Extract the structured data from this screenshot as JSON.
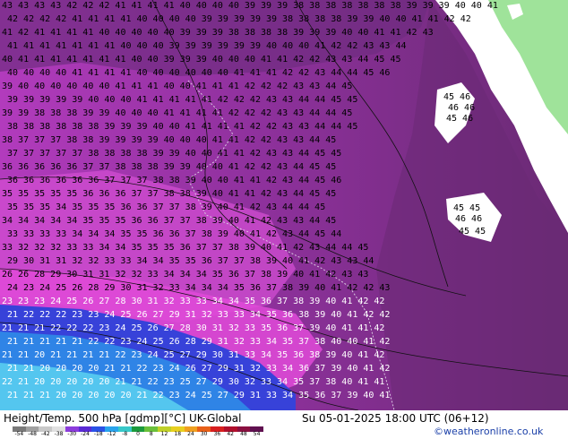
{
  "map": {
    "background": "#7a2f84",
    "land_color": "#9fe39a",
    "ocean_color": "#ffffff",
    "field_colors": {
      "warm_edge": "#5d2567",
      "mid": "#8a2e98",
      "bright": "#c040c8",
      "cool": "#e044d8",
      "cold_band": "#3c3cdc",
      "colder": "#2f8ee6",
      "coldest": "#55c8f0"
    },
    "contour_labels": [
      {
        "row": "row-42",
        "text": "43 43 43 43 42 42 42 41 41 41 41 40 40 40 40 39 39 39 38 38 38 38 38 38 38 39 39 39 40 40 41"
      },
      {
        "row": "row-41",
        "text": "42 42 42 42 41 41 41 41 40 40 40 40 39 39 39 39 39 38 38 38 38 39 39 40 40 41 41 42 42"
      },
      {
        "row": "row-40",
        "text": "41 42 41 41 41 41 40 40 40 40 40 39 39 39 38 38 38 38 39 39 39 40 40 41 41 42 43"
      },
      {
        "row": "row-39",
        "text": "41 41 41 41 41 41 41 40 40 40 39 39 39 39 39 39 40 40 40 41 42 42 43 43 44"
      },
      {
        "row": "row-38",
        "text": "40 41 41 41 41 41 41 41 40 40 39 39 39 40 40 40 41 41 42 42 43 43 44 45 45"
      },
      {
        "row": "row-37",
        "text": "40 40 40 40 41 41 41 41 40 40 40 40 40 40 41 41 41 42 42 43 44 44 45 46"
      },
      {
        "row": "row-36",
        "text": "39 40 40 40 40 40 40 41 41 41 40 40 41 41 41 42 42 42 43 43 44 45"
      },
      {
        "row": "row-35",
        "text": "39 39 39 39 39 40 40 40 41 41 41 41 41 42 42 42 43 43 44 44 45 45"
      },
      {
        "row": "row-34",
        "text": "39 39 38 38 38 39 39 40 40 40 41 41 41 41 42 42 42 43 43 44 44 45"
      },
      {
        "row": "row-33",
        "text": "38 38 38 38 38 38 39 39 39 40 40 41 41 41 41 42 42 43 43 44 44 45"
      },
      {
        "row": "row-32",
        "text": "38 37 37 37 38 38 39 39 39 39 40 40 40 41 41 42 42 43 43 44 45"
      },
      {
        "row": "row-31",
        "text": "37 37 37 37 37 38 38 38 38 39 39 40 40 41 41 42 43 43 44 45 45"
      },
      {
        "row": "row-30",
        "text": "36 36 36 36 36 37 37 38 38 38 39 39 40 40 41 42 42 43 44 45 45"
      },
      {
        "row": "row-29",
        "text": "36 36 36 36 36 36 37 37 37 38 38 39 40 40 41 41 42 43 44 45 46"
      },
      {
        "row": "row-28",
        "text": "35 35 35 35 35 36 36 36 37 37 38 38 39 40 41 41 42 43 44 45 45"
      },
      {
        "row": "row-27",
        "text": "35 35 35 34 35 35 35 36 36 37 37 38 39 40 41 42 43 44 44 45"
      },
      {
        "row": "row-26",
        "text": "34 34 34 34 34 35 35 35 36 36 37 37 38 39 40 41 42 43 43 44 45"
      },
      {
        "row": "row-25",
        "text": "33 33 33 33 34 34 34 35 35 36 36 37 38 39 40 41 42 43 44 45 44"
      },
      {
        "row": "row-24",
        "text": "33 32 32 32 33 33 34 34 35 35 35 36 37 37 38 39 40 41 42 43 44 44 45"
      },
      {
        "row": "row-23",
        "text": "29 30 31 31 32 32 33 33 34 34 35 35 36 37 37 38 39 40 41 42 43 43 44"
      },
      {
        "row": "row-22",
        "text": "26 26 28 29 30 31 31 32 32 33 34 34 34 35 36 37 38 39 40 41 42 43 43"
      },
      {
        "row": "row-21",
        "text": "24 23 24 25 26 28 29 30 31 32 33 34 34 34 35 36 37 38 39 40 41 42 42 43"
      },
      {
        "row": "row-20",
        "text": "23 23 23 24 25 26 27 28 30 31 32 33 33 34 34 35 36 37 38 39 40 41 42 42"
      },
      {
        "row": "row-19",
        "text": "21 22 22 22 23 23 24 25 26 27 29 31 32 33 33 34 35 36 38 39 40 41 42 42"
      },
      {
        "row": "row-18",
        "text": "21 21 21 22 22 22 23 24 25 26 27 28 30 31 32 33 35 36 37 39 40 41 41 42"
      },
      {
        "row": "row-17",
        "text": "21 21 21 21 21 22 22 23 24 25 26 28 29 31 32 33 34 35 37 38 40 40 41 42"
      },
      {
        "row": "row-16",
        "text": "21 21 20 21 21 21 21 22 23 24 25 27 29 30 31 33 34 35 36 38 39 40 41 42"
      },
      {
        "row": "row-15",
        "text": "21 21 20 20 20 20 21 21 22 23 24 26 27 29 31 32 33 34 36 37 39 40 41 42"
      },
      {
        "row": "row-14",
        "text": "22 21 20 20 20 20 20 21 21 22 23 25 27 29 30 32 33 34 35 37 38 40 41 41"
      },
      {
        "row": "row-13",
        "text": "21 21 21 20 20 20 20 20 21 22 23 24 25 27 29 31 33 34 35 36 37 39 40 41"
      }
    ],
    "land_labels": [
      {
        "name": "island-north",
        "text": "45 46"
      },
      {
        "name": "island-north-2",
        "text": "46 46"
      },
      {
        "name": "island-north-3",
        "text": "45 46"
      },
      {
        "name": "island-south",
        "text": "45 45"
      },
      {
        "name": "island-south-2",
        "text": "46 46"
      },
      {
        "name": "island-south-3",
        "text": "45 45"
      }
    ]
  },
  "footer": {
    "title": "Height/Temp. 500 hPa [gdmp][°C] UK-Global",
    "valid_time": "Su 05-01-2025 18:00 UTC (06+12)",
    "credit": "©weatheronline.co.uk"
  },
  "scale": {
    "labels": [
      "-54",
      "-48",
      "-42",
      "-38",
      "-30",
      "-24",
      "-18",
      "-12",
      "-8",
      "0",
      "8",
      "12",
      "18",
      "24",
      "30",
      "36",
      "42",
      "48",
      "54"
    ],
    "colors": [
      "#7a7a7a",
      "#a0a0a0",
      "#c8c8c8",
      "#e0e0e0",
      "#8c3cdc",
      "#5a2ad4",
      "#2a52e6",
      "#2aa4ec",
      "#38c8c8",
      "#1c9a3c",
      "#6ac03a",
      "#c0d028",
      "#e8d020",
      "#f0a020",
      "#e86018",
      "#d82020",
      "#b0102c",
      "#8a1040",
      "#601050"
    ]
  }
}
